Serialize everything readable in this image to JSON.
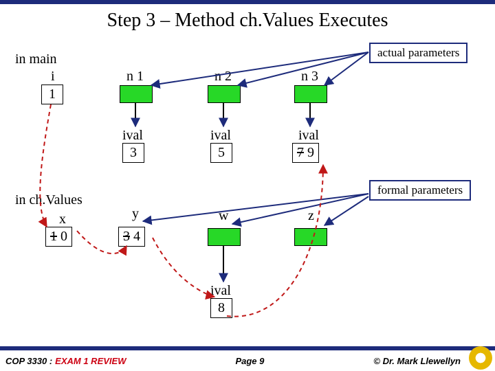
{
  "title": "Step 3 – Method  ch.Values Executes",
  "captions": {
    "actual": "actual parameters",
    "formal": "formal parameters"
  },
  "scopes": {
    "main": "in main",
    "chvalues": "in ch.Values"
  },
  "main": {
    "i": {
      "label": "i",
      "value": "1"
    }
  },
  "row_n": {
    "n1": {
      "label": "n 1"
    },
    "n2": {
      "label": "n 2"
    },
    "n3": {
      "label": "n 3"
    }
  },
  "row_ival_top": {
    "c1": {
      "label": "ival",
      "value": "3"
    },
    "c2": {
      "label": "ival",
      "value": "5"
    },
    "c3": {
      "label": "ival",
      "old": "7",
      "new": "9"
    }
  },
  "chvalues": {
    "x": {
      "label": "x",
      "old": "1",
      "new": "0"
    },
    "y": {
      "label": "y",
      "old": "3",
      "new": "4"
    },
    "w": {
      "label": "w"
    },
    "z": {
      "label": "z"
    }
  },
  "row_ival_bot": {
    "label": "ival",
    "value": "8"
  },
  "footer": {
    "course": "COP 3330 :",
    "subject": "EXAM 1 REVIEW",
    "page": "Page 9",
    "copyright": "© Dr. Mark Llewellyn"
  }
}
